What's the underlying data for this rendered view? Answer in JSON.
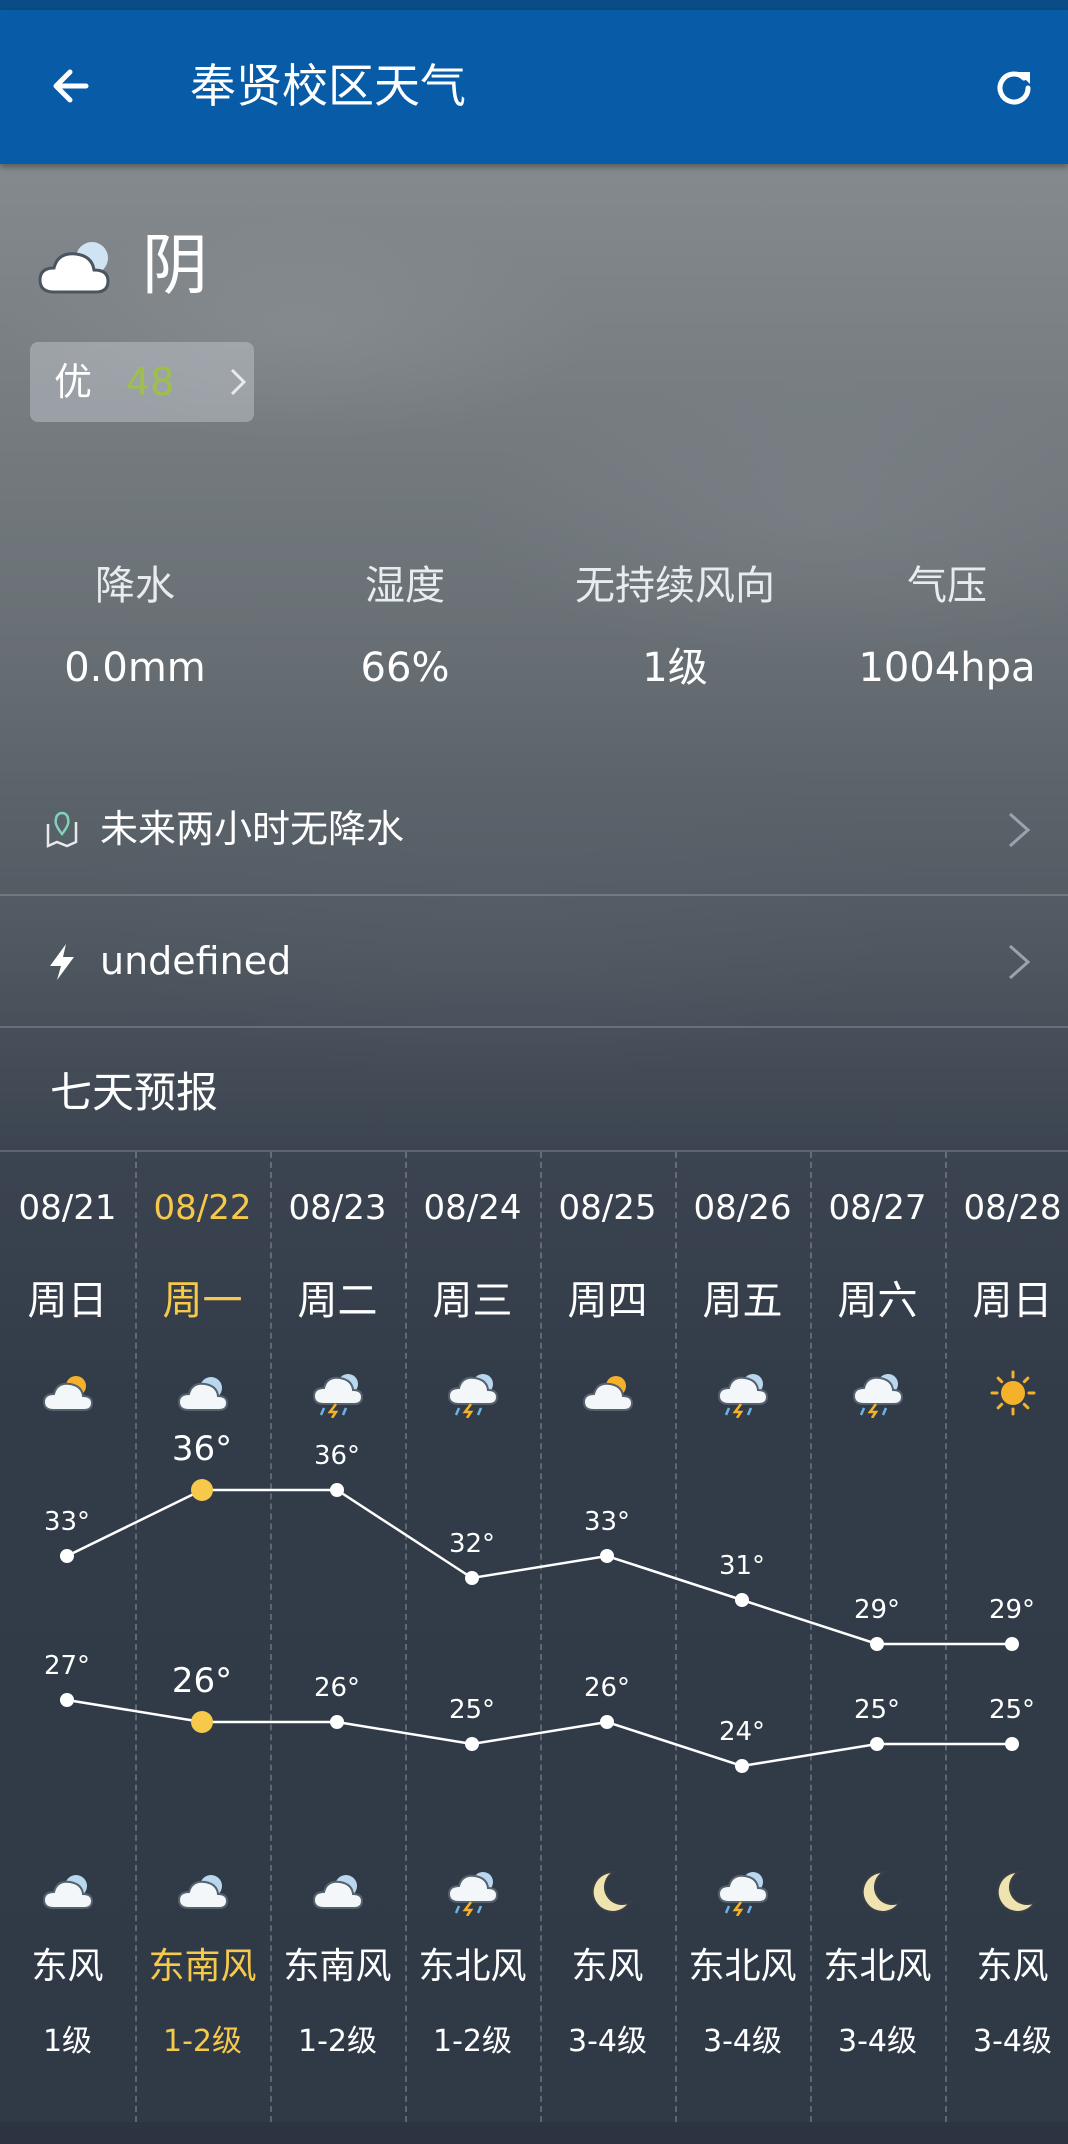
{
  "header": {
    "title": "奉贤校区天气"
  },
  "current": {
    "condition": "阴",
    "condition_icon": "cloudy-icon",
    "aqi": {
      "level": "优",
      "value": "48",
      "color": "#9ec04a"
    }
  },
  "stats": [
    {
      "label": "降水",
      "value": "0.0mm"
    },
    {
      "label": "湿度",
      "value": "66%"
    },
    {
      "label": "无持续风向",
      "value": "1级"
    },
    {
      "label": "气压",
      "value": "1004hpa"
    }
  ],
  "rows": {
    "precip_text": "未来两小时无降水",
    "alert_text": "undefined"
  },
  "forecast_title": "七天预报",
  "forecast": {
    "highlight_color": "#f6c94a",
    "days": [
      {
        "date": "08/21",
        "dow": "周日",
        "day_icon": "partly-cloudy-icon",
        "night_icon": "cloudy-icon",
        "high": 33,
        "low": 27,
        "high_label": "33°",
        "low_label": "27°",
        "wind": "东风",
        "level": "1级"
      },
      {
        "date": "08/22",
        "dow": "周一",
        "day_icon": "cloudy-icon",
        "night_icon": "cloudy-icon",
        "high": 36,
        "low": 26,
        "high_label": "36°",
        "low_label": "26°",
        "wind": "东南风",
        "level": "1-2级",
        "highlight": true
      },
      {
        "date": "08/23",
        "dow": "周二",
        "day_icon": "thunderstorm-icon",
        "night_icon": "cloudy-icon",
        "high": 36,
        "low": 26,
        "high_label": "36°",
        "low_label": "26°",
        "wind": "东南风",
        "level": "1-2级"
      },
      {
        "date": "08/24",
        "dow": "周三",
        "day_icon": "thunderstorm-icon",
        "night_icon": "thunderstorm-icon",
        "high": 32,
        "low": 25,
        "high_label": "32°",
        "low_label": "25°",
        "wind": "东北风",
        "level": "1-2级"
      },
      {
        "date": "08/25",
        "dow": "周四",
        "day_icon": "partly-cloudy-icon",
        "night_icon": "moon-icon",
        "high": 33,
        "low": 26,
        "high_label": "33°",
        "low_label": "26°",
        "wind": "东风",
        "level": "3-4级"
      },
      {
        "date": "08/26",
        "dow": "周五",
        "day_icon": "thunderstorm-icon",
        "night_icon": "thunderstorm-icon",
        "high": 31,
        "low": 24,
        "high_label": "31°",
        "low_label": "24°",
        "wind": "东北风",
        "level": "3-4级"
      },
      {
        "date": "08/27",
        "dow": "周六",
        "day_icon": "thunderstorm-icon",
        "night_icon": "moon-icon",
        "high": 29,
        "low": 25,
        "high_label": "29°",
        "low_label": "25°",
        "wind": "东北风",
        "level": "3-4级"
      },
      {
        "date": "08/28",
        "dow": "周日",
        "day_icon": "sun-icon",
        "night_icon": "moon-icon",
        "high": 29,
        "low": 25,
        "high_label": "29°",
        "low_label": "25°",
        "wind": "东风",
        "level": "3-4级"
      }
    ]
  }
}
